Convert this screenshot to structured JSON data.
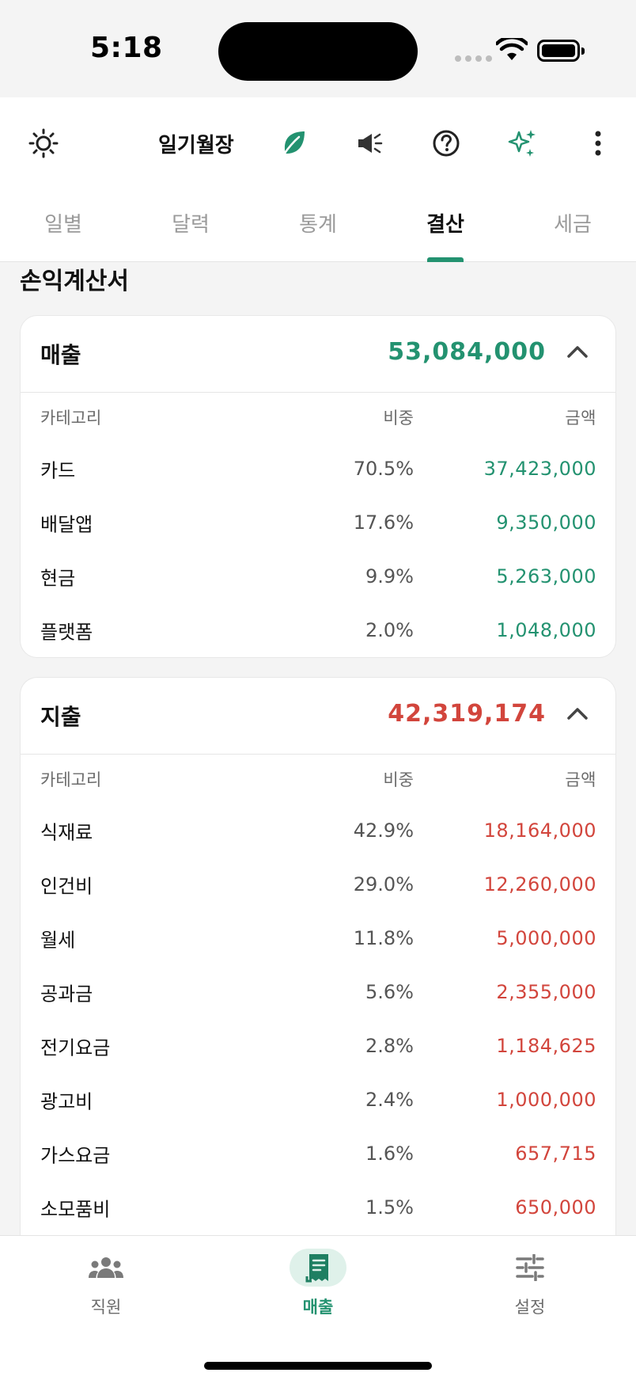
{
  "status_bar": {
    "time": "5:18"
  },
  "header": {
    "app_title": "일기월장",
    "icons": [
      "sun-icon",
      "leaf-icon",
      "megaphone-icon",
      "help-icon",
      "sparkles-icon",
      "more-vert-icon"
    ]
  },
  "tabs": [
    {
      "label": "일별",
      "active": false
    },
    {
      "label": "달력",
      "active": false
    },
    {
      "label": "통계",
      "active": false
    },
    {
      "label": "결산",
      "active": true
    },
    {
      "label": "세금",
      "active": false
    }
  ],
  "section_title": "손익계산서",
  "revenue": {
    "title": "매출",
    "total": "53,084,000",
    "columns": {
      "category": "카테고리",
      "ratio": "비중",
      "amount": "금액"
    },
    "rows": [
      {
        "name": "카드",
        "ratio": "70.5%",
        "amount": "37,423,000"
      },
      {
        "name": "배달앱",
        "ratio": "17.6%",
        "amount": "9,350,000"
      },
      {
        "name": "현금",
        "ratio": "9.9%",
        "amount": "5,263,000"
      },
      {
        "name": "플랫폼",
        "ratio": "2.0%",
        "amount": "1,048,000"
      }
    ]
  },
  "expense": {
    "title": "지출",
    "total": "42,319,174",
    "columns": {
      "category": "카테고리",
      "ratio": "비중",
      "amount": "금액"
    },
    "rows": [
      {
        "name": "식재료",
        "ratio": "42.9%",
        "amount": "18,164,000"
      },
      {
        "name": "인건비",
        "ratio": "29.0%",
        "amount": "12,260,000"
      },
      {
        "name": "월세",
        "ratio": "11.8%",
        "amount": "5,000,000"
      },
      {
        "name": "공과금",
        "ratio": "5.6%",
        "amount": "2,355,000"
      },
      {
        "name": "전기요금",
        "ratio": "2.8%",
        "amount": "1,184,625"
      },
      {
        "name": "광고비",
        "ratio": "2.4%",
        "amount": "1,000,000"
      },
      {
        "name": "가스요금",
        "ratio": "1.6%",
        "amount": "657,715"
      },
      {
        "name": "소모품비",
        "ratio": "1.5%",
        "amount": "650,000"
      }
    ]
  },
  "bottom_nav": [
    {
      "label": "직원",
      "icon": "people-icon",
      "active": false
    },
    {
      "label": "매출",
      "icon": "receipt-icon",
      "active": true
    },
    {
      "label": "설정",
      "icon": "sliders-icon",
      "active": false
    }
  ],
  "colors": {
    "accent": "#239270",
    "revenue": "#239270",
    "expense": "#d2453c"
  }
}
